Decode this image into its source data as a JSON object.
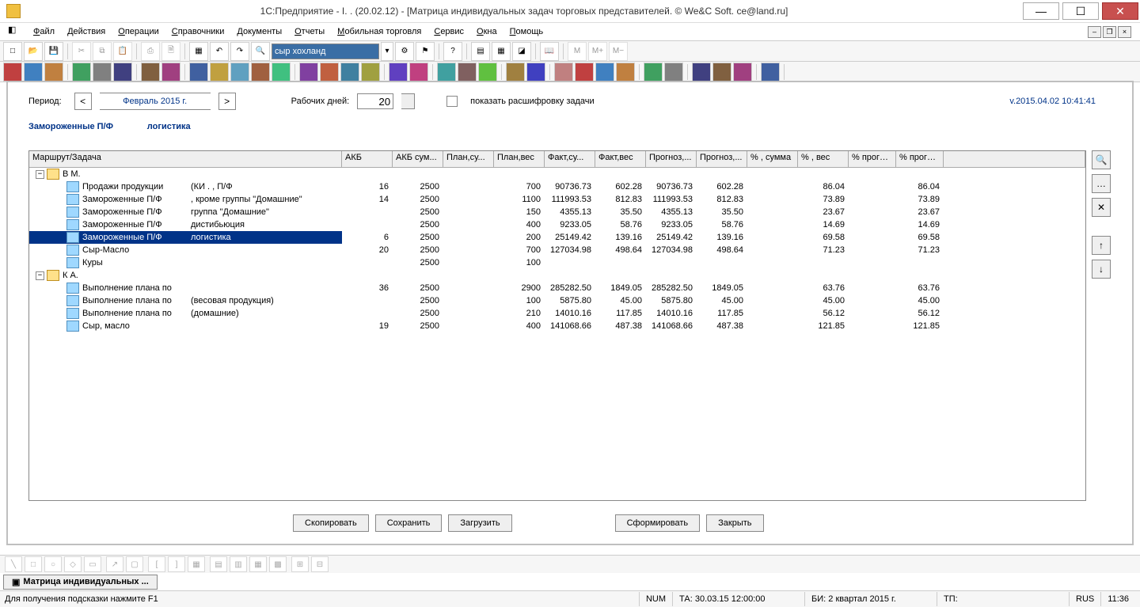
{
  "title": "1С:Предприятие - I.        . (20.02.12) - [Матрица индивидуальных задач торговых представителей. © We&C Soft. ce@land.ru]",
  "menu": [
    "Файл",
    "Действия",
    "Операции",
    "Справочники",
    "Документы",
    "Отчеты",
    "Мобильная торговля",
    "Сервис",
    "Окна",
    "Помощь"
  ],
  "search_value": "сыр хохланд",
  "period": {
    "label": "Период:",
    "value": "Февраль 2015 г."
  },
  "workdays": {
    "label": "Рабочих дней:",
    "value": "20"
  },
  "decode_checkbox": "показать расшифровку задачи",
  "version": "v.2015.04.02 10:41:41",
  "header_group": "Замороженные П/Ф",
  "header_sub": "логистика",
  "columns": [
    "Маршрут/Задача",
    "АКБ",
    "АКБ сум...",
    "План,су...",
    "План,вес",
    "Факт,су...",
    "Факт,вес",
    "Прогноз,...",
    "Прогноз,...",
    "% , сумма",
    "% , вес",
    "% прогно...",
    "% прогно..."
  ],
  "rows": [
    {
      "lvl": 0,
      "exp": "-",
      "icon": "open",
      "label": "В            М.",
      "sel": false,
      "v": [
        "",
        "",
        "",
        "",
        "",
        "",
        "",
        "",
        "",
        "",
        "",
        ""
      ]
    },
    {
      "lvl": 1,
      "exp": "",
      "icon": "blue",
      "label": "Продажи продукции",
      "extra": "(КИ .                               , П/Ф",
      "sel": false,
      "v": [
        "16",
        "2500",
        "",
        "700",
        "90736.73",
        "602.28",
        "90736.73",
        "602.28",
        "",
        "86.04",
        "",
        "86.04"
      ]
    },
    {
      "lvl": 1,
      "exp": "",
      "icon": "blue",
      "label": "Замороженные П/Ф",
      "extra": ", кроме группы \"Домашние\"",
      "sel": false,
      "v": [
        "14",
        "2500",
        "",
        "1100",
        "111993.53",
        "812.83",
        "111993.53",
        "812.83",
        "",
        "73.89",
        "",
        "73.89"
      ]
    },
    {
      "lvl": 1,
      "exp": "",
      "icon": "blue",
      "label": "Замороженные П/Ф",
      "extra": "группа \"Домашние\"",
      "sel": false,
      "v": [
        "",
        "2500",
        "",
        "150",
        "4355.13",
        "35.50",
        "4355.13",
        "35.50",
        "",
        "23.67",
        "",
        "23.67"
      ]
    },
    {
      "lvl": 1,
      "exp": "",
      "icon": "blue",
      "label": "Замороженные П/Ф",
      "extra": "дистибьюция",
      "sel": false,
      "v": [
        "",
        "2500",
        "",
        "400",
        "9233.05",
        "58.76",
        "9233.05",
        "58.76",
        "",
        "14.69",
        "",
        "14.69"
      ]
    },
    {
      "lvl": 1,
      "exp": "",
      "icon": "blue",
      "label": "Замороженные П/Ф",
      "extra": "логистика",
      "sel": true,
      "v": [
        "6",
        "2500",
        "",
        "200",
        "25149.42",
        "139.16",
        "25149.42",
        "139.16",
        "",
        "69.58",
        "",
        "69.58"
      ]
    },
    {
      "lvl": 1,
      "exp": "",
      "icon": "blue",
      "label": "Сыр-Масло",
      "extra": "",
      "sel": false,
      "v": [
        "20",
        "2500",
        "",
        "700",
        "127034.98",
        "498.64",
        "127034.98",
        "498.64",
        "",
        "71.23",
        "",
        "71.23"
      ]
    },
    {
      "lvl": 1,
      "exp": "",
      "icon": "blue",
      "label": "Куры",
      "extra": "",
      "sel": false,
      "v": [
        "",
        "2500",
        "",
        "100",
        "",
        "",
        "",
        "",
        "",
        "",
        "",
        ""
      ]
    },
    {
      "lvl": 0,
      "exp": "-",
      "icon": "open",
      "label": "К              А.",
      "sel": false,
      "v": [
        "",
        "",
        "",
        "",
        "",
        "",
        "",
        "",
        "",
        "",
        "",
        ""
      ]
    },
    {
      "lvl": 1,
      "exp": "",
      "icon": "blue",
      "label": "Выполнение плана по",
      "extra": "",
      "sel": false,
      "v": [
        "36",
        "2500",
        "",
        "2900",
        "285282.50",
        "1849.05",
        "285282.50",
        "1849.05",
        "",
        "63.76",
        "",
        "63.76"
      ]
    },
    {
      "lvl": 1,
      "exp": "",
      "icon": "blue",
      "label": "Выполнение плана по",
      "extra": "(весовая продукция)",
      "sel": false,
      "v": [
        "",
        "2500",
        "",
        "100",
        "5875.80",
        "45.00",
        "5875.80",
        "45.00",
        "",
        "45.00",
        "",
        "45.00"
      ]
    },
    {
      "lvl": 1,
      "exp": "",
      "icon": "blue",
      "label": "Выполнение плана по",
      "extra": "(домашние)",
      "sel": false,
      "v": [
        "",
        "2500",
        "",
        "210",
        "14010.16",
        "117.85",
        "14010.16",
        "117.85",
        "",
        "56.12",
        "",
        "56.12"
      ]
    },
    {
      "lvl": 1,
      "exp": "",
      "icon": "blue",
      "label": "Сыр, масло",
      "extra": "",
      "sel": false,
      "v": [
        "19",
        "2500",
        "",
        "400",
        "141068.66",
        "487.38",
        "141068.66",
        "487.38",
        "",
        "121.85",
        "",
        "121.85"
      ]
    }
  ],
  "buttons": {
    "copy": "Скопировать",
    "save": "Сохранить",
    "load": "Загрузить",
    "form": "Сформировать",
    "close": "Закрыть"
  },
  "doc_tab": "Матрица индивидуальных ...",
  "status": {
    "hint": "Для получения подсказки нажмите F1",
    "num": "NUM",
    "ta": "ТА: 30.03.15  12:00:00",
    "bi": "БИ: 2 квартал 2015 г.",
    "tp": "ТП:",
    "lang": "RUS",
    "time": "11:36"
  }
}
